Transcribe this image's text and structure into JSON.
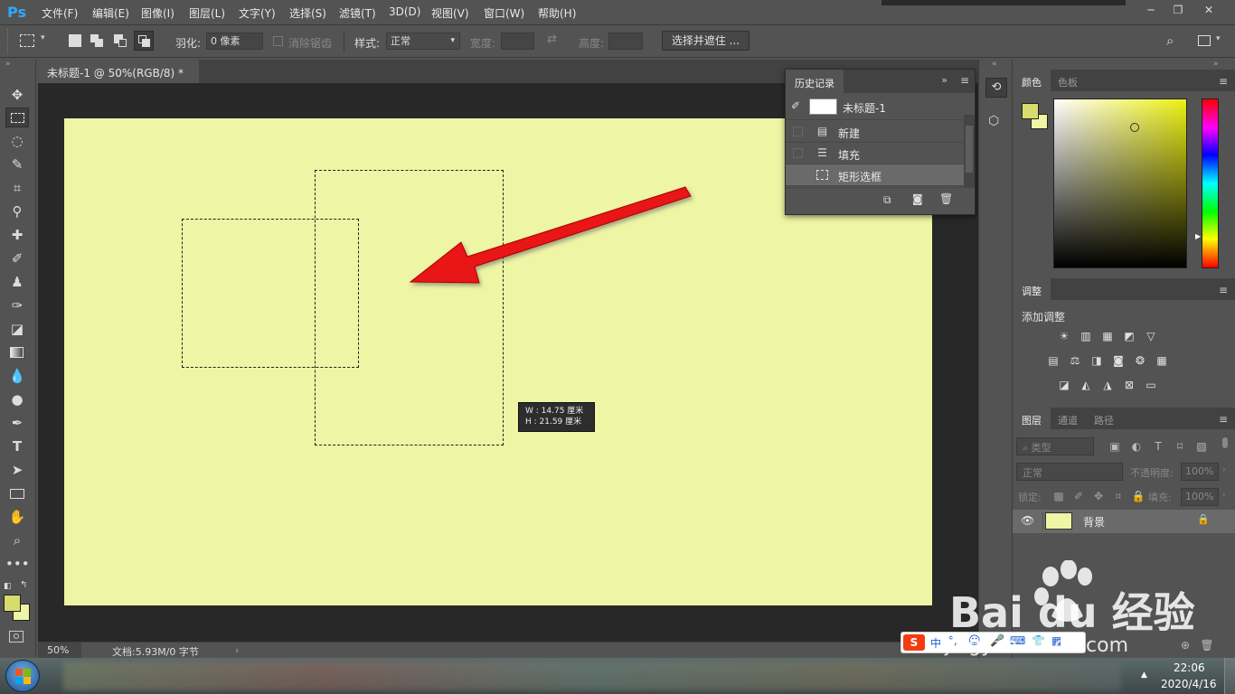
{
  "app": {
    "logo": "Ps",
    "menu": [
      "文件(F)",
      "编辑(E)",
      "图像(I)",
      "图层(L)",
      "文字(Y)",
      "选择(S)",
      "滤镜(T)",
      "3D(D)",
      "视图(V)",
      "窗口(W)",
      "帮助(H)"
    ]
  },
  "options": {
    "feather_label": "羽化:",
    "feather_value": "0 像素",
    "antialias_label": "消除锯齿",
    "style_label": "样式:",
    "style_value": "正常",
    "width_label": "宽度:",
    "height_label": "高度:",
    "select_mask_button": "选择并遮住 ..."
  },
  "document": {
    "tab_title": "未标题-1 @ 50%(RGB/8) *",
    "canvas_color": "#eef5a4",
    "zoom": "50%",
    "doc_info": "文档:5.93M/0 字节"
  },
  "tooltip": {
    "w_line": "W :  14.75  厘米",
    "h_line": "H :  21.59  厘米"
  },
  "history": {
    "tab": "历史记录",
    "snapshot": "未标题-1",
    "items": [
      "新建",
      "填充",
      "矩形选框"
    ]
  },
  "color_panel": {
    "tabs": [
      "颜色",
      "色板"
    ],
    "foreground": "#d8dc6c",
    "background": "#eef5a4",
    "hue_color": "#eef014"
  },
  "adjust_panel": {
    "tab": "调整",
    "title": "添加调整"
  },
  "layers_panel": {
    "tabs": [
      "图层",
      "通道",
      "路径"
    ],
    "filter_kind": "类型",
    "blend_mode": "正常",
    "opacity_label": "不透明度:",
    "opacity_value": "100%",
    "lock_label": "锁定:",
    "fill_label": "填充:",
    "fill_value": "100%",
    "layer_name": "背景"
  },
  "taskbar": {
    "time": "22:06",
    "date": "2020/4/16",
    "ime": "中"
  },
  "watermark": {
    "brand": "Bai du 经验",
    "url": "jingyan.baidu.com"
  }
}
